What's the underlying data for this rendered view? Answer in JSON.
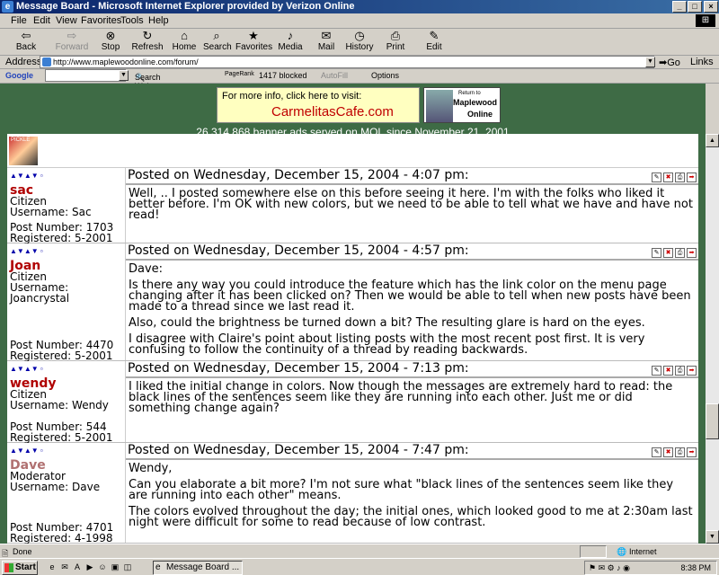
{
  "window": {
    "title": "Message Board - Microsoft Internet Explorer provided by Verizon Online"
  },
  "menu": [
    "File",
    "Edit",
    "View",
    "Favorites",
    "Tools",
    "Help"
  ],
  "toolbar": [
    {
      "label": "Back",
      "icon": "back-icon",
      "glyph": "⇦",
      "enabled": true
    },
    {
      "label": "Forward",
      "icon": "forward-icon",
      "glyph": "⇨",
      "enabled": false
    },
    {
      "label": "Stop",
      "icon": "stop-icon",
      "glyph": "⊗",
      "enabled": true
    },
    {
      "label": "Refresh",
      "icon": "refresh-icon",
      "glyph": "↻",
      "enabled": true
    },
    {
      "label": "Home",
      "icon": "home-icon",
      "glyph": "⌂",
      "enabled": true
    },
    {
      "label": "Search",
      "icon": "search-icon",
      "glyph": "⌕",
      "enabled": true
    },
    {
      "label": "Favorites",
      "icon": "favorites-icon",
      "glyph": "★",
      "enabled": true
    },
    {
      "label": "Media",
      "icon": "media-icon",
      "glyph": "♪",
      "enabled": true
    },
    {
      "label": "Mail",
      "icon": "mail-icon",
      "glyph": "✉",
      "enabled": true
    },
    {
      "label": "History",
      "icon": "history-icon",
      "glyph": "◷",
      "enabled": true
    },
    {
      "label": "Print",
      "icon": "print-icon",
      "glyph": "⎙",
      "enabled": true
    },
    {
      "label": "Edit",
      "icon": "edit-icon",
      "glyph": "✎",
      "enabled": true
    }
  ],
  "address": {
    "label": "Address",
    "url": "http://www.maplewoodonline.com/forum/",
    "go": "Go",
    "links": "Links"
  },
  "googlebar": {
    "google": "Google",
    "search_web": "Search Web",
    "pagerank": "PageRank",
    "blocked": "1417 blocked",
    "autofill": "AutoFill",
    "options": "Options"
  },
  "banner": {
    "line1": "For more info, click here to visit:",
    "line2": "CarmelitasCafe.com",
    "return1": "Return to",
    "return2": "Maplewood",
    "return3": "Online"
  },
  "adcount": "26,314,868 banner ads served on MOL since November 21, 2001",
  "posts": [
    {
      "name": "sac",
      "name_color": "#b00000",
      "role": "Citizen",
      "username": "Username: Sac",
      "postnum": "Post Number: 1703",
      "registered": "Registered: 5-2001",
      "posted": "Posted on Wednesday, December 15, 2004 - 4:07 pm:",
      "body": [
        "Well, .. I posted somewhere else on this before seeing it here. I'm with the folks who liked it better before. I'm OK with new colors, but we need to be able to tell what we have and have not read!"
      ]
    },
    {
      "name": "Joan",
      "name_color": "#b00000",
      "role": "Citizen",
      "username": "Username: Joancrystal",
      "postnum": "Post Number: 4470",
      "registered": "Registered: 5-2001",
      "posted": "Posted on Wednesday, December 15, 2004 - 4:57 pm:",
      "body": [
        "Dave:",
        "Is there any way you could introduce the feature which has the link color on the menu page changing after it has been clicked on? Then we would be able to tell when new posts have been made to a thread since we last read it.",
        "Also, could the brightness be turned down a bit? The resulting glare is hard on the eyes.",
        "I disagree with Claire's point about listing posts with the most recent post first. It is very confusing to follow the continuity of a thread by reading backwards."
      ]
    },
    {
      "name": "wendy",
      "name_color": "#b00000",
      "role": "Citizen",
      "username": "Username: Wendy",
      "postnum": "Post Number: 544",
      "registered": "Registered: 5-2001",
      "posted": "Posted on Wednesday, December 15, 2004 - 7:13 pm:",
      "body": [
        "I liked the initial change in colors. Now though the messages are extremely hard to read: the black lines of the sentences seem like they are running into each other. Just me or did something change again?"
      ]
    },
    {
      "name": "Dave",
      "name_color": "#b07070",
      "role": "Moderator",
      "username": "Username: Dave",
      "postnum": "Post Number: 4701",
      "registered": "Registered: 4-1998",
      "posted": "Posted on Wednesday, December 15, 2004 - 7:47 pm:",
      "body": [
        "Wendy,",
        "Can you elaborate a bit more? I'm not sure what \"black lines of the sentences seem like they are running into each other\" means.",
        "The colors evolved throughout the day; the initial ones, which looked good to me at 2:30am last night were difficult for some to read because of low contrast."
      ]
    }
  ],
  "status": {
    "text": "Done",
    "zone": "Internet"
  },
  "taskbar": {
    "start": "Start",
    "item": "Message Board ...",
    "clock": "8:38 PM"
  }
}
